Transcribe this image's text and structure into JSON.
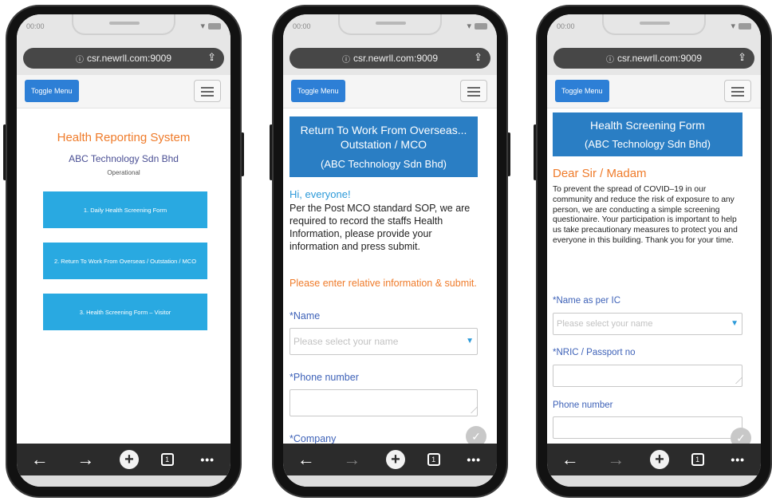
{
  "browser": {
    "time": "00:00",
    "url": "csr.newrll.com:9009",
    "tabs_count": "1"
  },
  "nav": {
    "toggle_label": "Toggle Menu"
  },
  "screen1": {
    "title": "Health Reporting System",
    "company": "ABC Technology Sdn Bhd",
    "status": "Operational",
    "menu": [
      "1. Daily Health Screening Form",
      "2. Return To Work From Overseas / Outstation / MCO",
      "3. Health Screening Form – Visitor"
    ]
  },
  "screen2": {
    "header_line1": "Return To Work From Overseas...",
    "header_line2": "Outstation / MCO",
    "header_line3": "(ABC Technology Sdn Bhd)",
    "greeting": "Hi, everyone!",
    "intro": "Per the Post MCO standard SOP, we are required to record the staffs Health Information, please provide your information and press submit.",
    "instruction": "Please enter relative information & submit.",
    "name_label": "*Name",
    "name_placeholder": "Please select your name",
    "phone_label": "*Phone number",
    "company_label": "*Company"
  },
  "screen3": {
    "header_line1": "Health Screening Form",
    "header_line2": "(ABC Technology Sdn Bhd)",
    "salutation": "Dear Sir / Madam",
    "paragraph": "To prevent the spread of COVID–19 in our community and reduce the risk of exposure to any person, we are conducting a simple screening questionaire. Your participation is important to help us take precautionary measures to protect you and everyone in this building. Thank you for your time.",
    "name_label": "*Name as per IC",
    "name_placeholder": "Please select your name",
    "nric_label": "*NRIC / Passport no",
    "phone_label": "Phone number"
  },
  "colors": {
    "accent_orange": "#ef7b2a",
    "header_blue": "#2a7ec4",
    "menu_blue": "#29a9e1",
    "toggle_blue": "#2d7fd6"
  }
}
